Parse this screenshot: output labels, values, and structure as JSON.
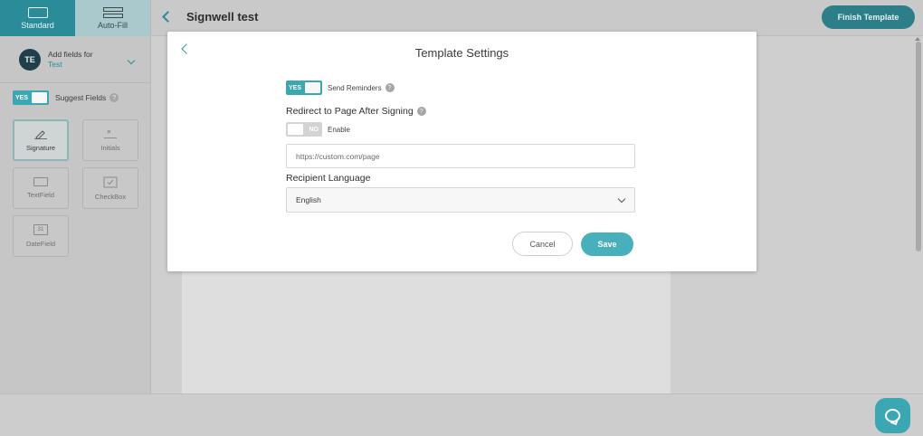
{
  "sidebar": {
    "mode_tabs": [
      {
        "label": "Standard",
        "icon": "standard-icon",
        "active": true
      },
      {
        "label": "Auto-Fill",
        "icon": "autofill-icon",
        "active": false
      }
    ],
    "recipient": {
      "initials": "TE",
      "label": "Add fields for",
      "name": "Test"
    },
    "suggest_fields": {
      "toggle_label": "YES",
      "label": "Suggest Fields",
      "help": "?"
    },
    "fields": [
      {
        "label": "Signature",
        "icon": "signature-icon"
      },
      {
        "label": "Initials",
        "icon": "initials-icon"
      },
      {
        "label": "TextField",
        "icon": "textfield-icon"
      },
      {
        "label": "CheckBox",
        "icon": "checkbox-icon"
      },
      {
        "label": "DateField",
        "icon": "datefield-icon",
        "glyph": "31"
      }
    ]
  },
  "header": {
    "title": "Signwell test",
    "finish_label": "Finish Template"
  },
  "modal": {
    "title": "Template Settings",
    "reminders": {
      "toggle_label": "YES",
      "label": "Send Reminders",
      "help": "?"
    },
    "redirect": {
      "title": "Redirect to Page After Signing",
      "help": "?",
      "toggle_label": "NO",
      "label": "Enable"
    },
    "url_input": {
      "placeholder": "https://custom.com/page",
      "value": ""
    },
    "language": {
      "title": "Recipient Language",
      "selected": "English"
    },
    "cancel_label": "Cancel",
    "save_label": "Save"
  },
  "colors": {
    "accent": "#2a8c98",
    "accent_light": "#47b0bc",
    "overlay": "#cfcfcf"
  }
}
